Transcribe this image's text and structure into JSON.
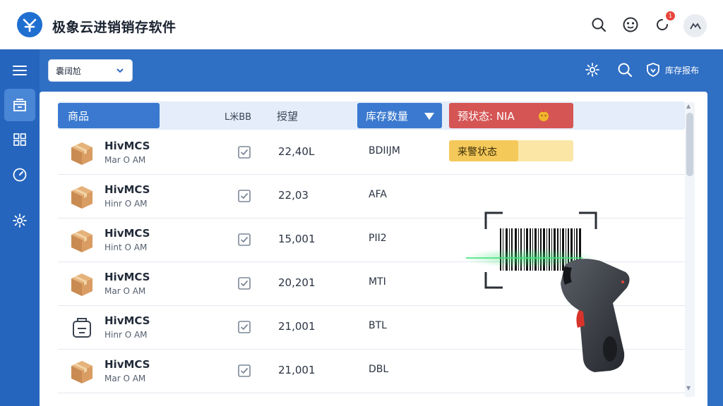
{
  "app": {
    "title": "极象云进销销存软件",
    "notification_count": "1"
  },
  "toolbar": {
    "store_select_value": "囊阔尬",
    "inventory_report_label": "库存报布"
  },
  "table": {
    "headers": {
      "goods": "商品",
      "col2": "L米BB",
      "qty": "授望",
      "stock": "库存数量",
      "warn": "预状态: NIA"
    },
    "warning_tag": "来警状态",
    "rows": [
      {
        "name": "HivMCS",
        "sub": "Mar O AM",
        "qty": "22,40L",
        "code": "BDIIJM",
        "icon": "package-icon"
      },
      {
        "name": "HivMCS",
        "sub": "Hinr O AM",
        "qty": "22,03",
        "code": "AFA",
        "icon": "package-icon"
      },
      {
        "name": "HivMCS",
        "sub": "Hint O AM",
        "qty": "15,001",
        "code": "PII2",
        "icon": "package-icon"
      },
      {
        "name": "HivMCS",
        "sub": "Mar O AM",
        "qty": "20,201",
        "code": "MTI",
        "icon": "package-icon"
      },
      {
        "name": "HivMCS",
        "sub": "Hinr O AM",
        "qty": "21,001",
        "code": "BTL",
        "icon": "box-outline-icon"
      },
      {
        "name": "HivMCS",
        "sub": "Mar O AM",
        "qty": "21,001",
        "code": "DBL",
        "icon": "package-icon"
      }
    ]
  },
  "colors": {
    "primary": "#2f6fc4",
    "header_active": "#3a79cf",
    "warn_header": "#d55555",
    "warn_tag": "#f4c95a"
  }
}
